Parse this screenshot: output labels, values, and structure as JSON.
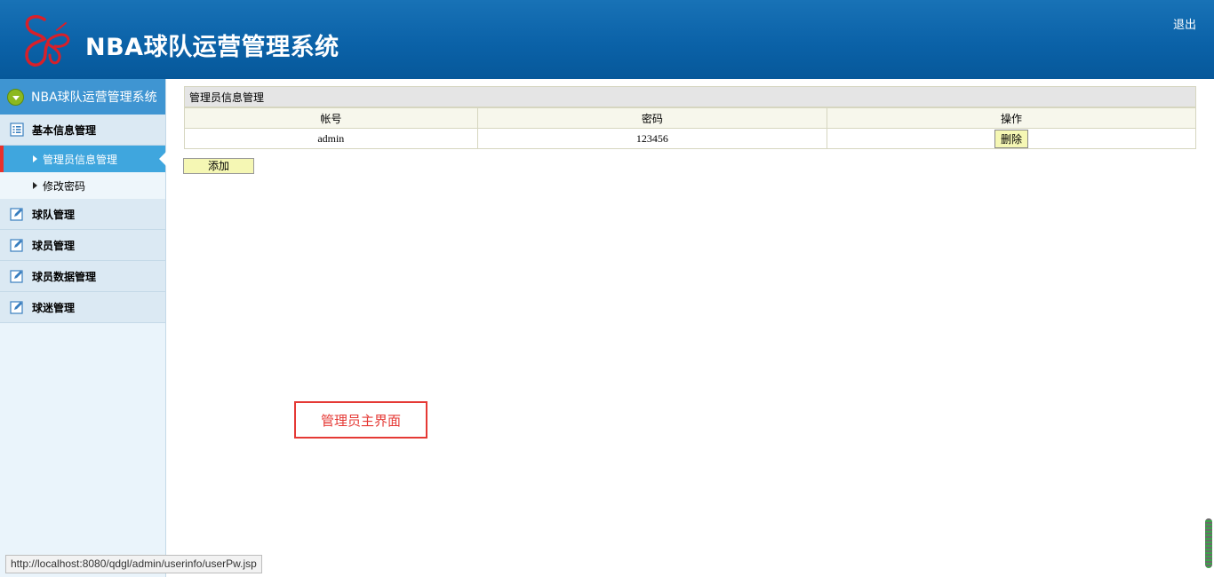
{
  "header": {
    "title": "NBA球队运营管理系统",
    "logout_label": "退出",
    "logo_icon": "butterfly-logo-icon"
  },
  "sidebar": {
    "heading": "NBA球队运营管理系统",
    "groups": [
      {
        "label": "基本信息管理",
        "icon": "list-icon",
        "items": [
          {
            "label": "管理员信息管理",
            "active": true
          },
          {
            "label": "修改密码",
            "active": false
          }
        ]
      },
      {
        "label": "球队管理",
        "icon": "edit-icon"
      },
      {
        "label": "球员管理",
        "icon": "edit-icon"
      },
      {
        "label": "球员数据管理",
        "icon": "edit-icon"
      },
      {
        "label": "球迷管理",
        "icon": "edit-icon"
      }
    ]
  },
  "main": {
    "panel_title": "管理员信息管理",
    "columns": [
      "帐号",
      "密码",
      "操作"
    ],
    "rows": [
      {
        "account": "admin",
        "password": "123456",
        "action": "删除"
      }
    ],
    "add_label": "添加"
  },
  "annotation": "管理员主界面",
  "status_bar_url": "http://localhost:8080/qdgl/admin/userinfo/userPw.jsp",
  "colors": {
    "header": "#0b62a8",
    "sidebar_active": "#3fa6de",
    "button": "#f5f7b4",
    "annotation": "#e53935"
  }
}
